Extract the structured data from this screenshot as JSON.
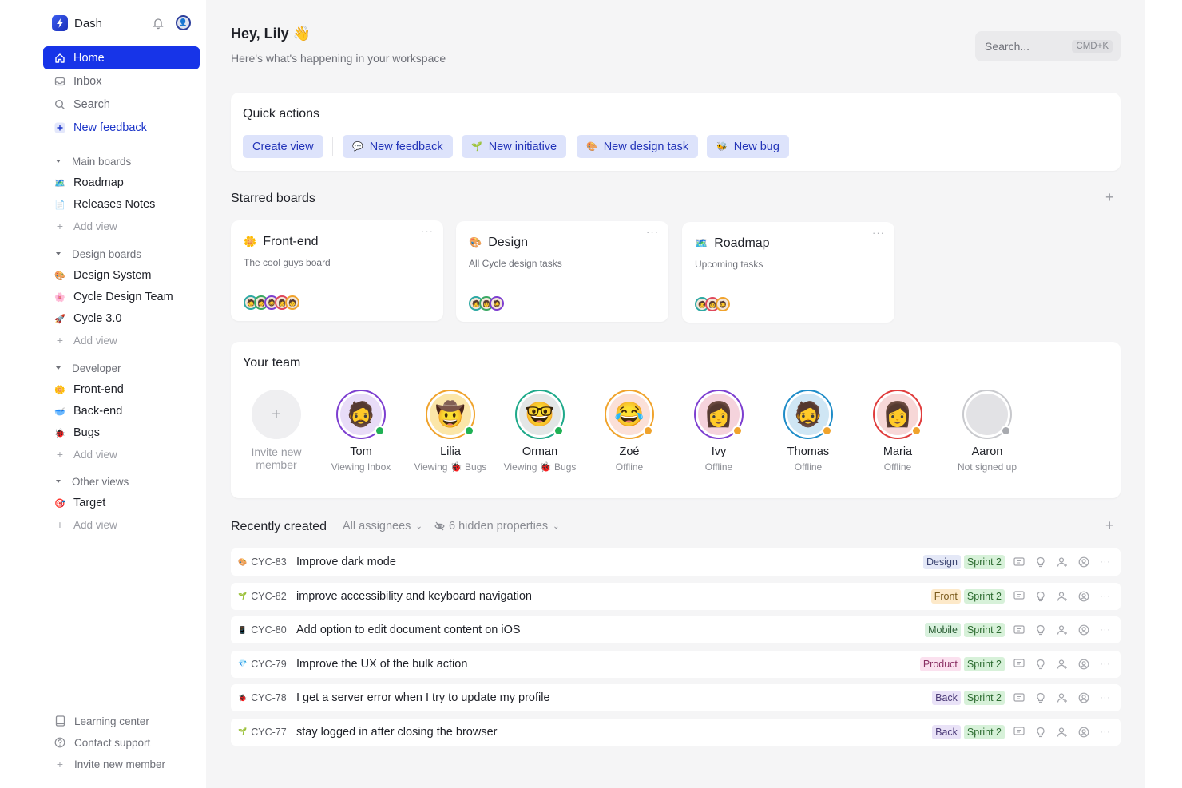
{
  "app": {
    "name": "Dash"
  },
  "sidebar": {
    "nav": [
      {
        "label": "Home",
        "icon": "home-icon"
      },
      {
        "label": "Inbox",
        "icon": "inbox-icon"
      },
      {
        "label": "Search",
        "icon": "search-icon"
      },
      {
        "label": "New feedback",
        "icon": "plus-icon"
      }
    ],
    "sections": [
      {
        "title": "Main boards",
        "items": [
          {
            "label": "Roadmap",
            "emoji": "🗺️"
          },
          {
            "label": "Releases Notes",
            "emoji": "📄"
          }
        ],
        "add_label": "Add view"
      },
      {
        "title": "Design boards",
        "items": [
          {
            "label": "Design System",
            "emoji": "🎨"
          },
          {
            "label": "Cycle Design Team",
            "emoji": "🌸"
          },
          {
            "label": "Cycle 3.0",
            "emoji": "🚀"
          }
        ],
        "add_label": "Add view"
      },
      {
        "title": "Developer",
        "items": [
          {
            "label": "Front-end",
            "emoji": "🌼"
          },
          {
            "label": "Back-end",
            "emoji": "🥣"
          },
          {
            "label": "Bugs",
            "emoji": "🐞"
          }
        ],
        "add_label": "Add view"
      },
      {
        "title": "Other views",
        "items": [
          {
            "label": "Target",
            "emoji": "🎯"
          }
        ],
        "add_label": "Add view"
      }
    ],
    "footer": [
      {
        "label": "Learning center",
        "icon": "book-icon"
      },
      {
        "label": "Contact support",
        "icon": "help-icon"
      },
      {
        "label": "Invite new member",
        "icon": "plus-icon"
      }
    ]
  },
  "header": {
    "greeting": "Hey, Lily 👋",
    "subtitle": "Here's what's happening in your workspace",
    "search_placeholder": "Search...",
    "search_shortcut": "CMD+K"
  },
  "quick_actions": {
    "title": "Quick actions",
    "buttons": [
      {
        "label": "Create view",
        "emoji": ""
      },
      {
        "label": "New feedback",
        "emoji": "💬"
      },
      {
        "label": "New initiative",
        "emoji": "🌱"
      },
      {
        "label": "New design task",
        "emoji": "🎨"
      },
      {
        "label": "New bug",
        "emoji": "🐝"
      }
    ]
  },
  "starred": {
    "title": "Starred boards",
    "boards": [
      {
        "name": "Front-end",
        "emoji": "🌼",
        "subtitle": "The cool guys board",
        "avatars": [
          "#2ea9a4",
          "#3aa864",
          "#7d3fd0",
          "#e0495c",
          "#f0a32c"
        ]
      },
      {
        "name": "Design",
        "emoji": "🎨",
        "subtitle": "All Cycle design tasks",
        "avatars": [
          "#2ea9a4",
          "#3aa864",
          "#7d3fd0"
        ]
      },
      {
        "name": "Roadmap",
        "emoji": "🗺️",
        "subtitle": "Upcoming tasks",
        "avatars": [
          "#2ea9a4",
          "#e0495c",
          "#f0a32c"
        ]
      }
    ]
  },
  "team": {
    "title": "Your team",
    "invite_label": "Invite new member",
    "members": [
      {
        "name": "Tom",
        "status": "Viewing Inbox",
        "face": "🧔",
        "ring": "#7d3fd0",
        "bg": "#e8dcf7",
        "presence": "#1fb154"
      },
      {
        "name": "Lilia",
        "status": "Viewing 🐞 Bugs",
        "face": "🤠",
        "ring": "#f0a32c",
        "bg": "#fbe6a8",
        "presence": "#1fb154"
      },
      {
        "name": "Orman",
        "status": "Viewing 🐞 Bugs",
        "face": "🤓",
        "ring": "#1fa98a",
        "bg": "#e3e6e6",
        "presence": "#1fb154"
      },
      {
        "name": "Zoé",
        "status": "Offline",
        "face": "😂",
        "ring": "#f0a32c",
        "bg": "#fbe0d8",
        "presence": "#f0a32c"
      },
      {
        "name": "Ivy",
        "status": "Offline",
        "face": "👩",
        "ring": "#7d3fd0",
        "bg": "#f5d3dc",
        "presence": "#f0a32c"
      },
      {
        "name": "Thomas",
        "status": "Offline",
        "face": "🧔",
        "ring": "#1e8cc8",
        "bg": "#cfe6f4",
        "presence": "#f0a32c"
      },
      {
        "name": "Maria",
        "status": "Offline",
        "face": "👩",
        "ring": "#e03c3c",
        "bg": "#f7d7d7",
        "presence": "#f0a32c"
      },
      {
        "name": "Aaron",
        "status": "Not signed up",
        "face": "",
        "ring": "#c8c9cd",
        "bg": "#e2e2e5",
        "presence": "#a8aaaf"
      }
    ]
  },
  "recent": {
    "title": "Recently created",
    "filter_assignees": "All assignees",
    "filter_hidden": "6 hidden properties",
    "rows": [
      {
        "id": "CYC-83",
        "emoji": "🎨",
        "title": "Improve dark mode",
        "tag": "Design",
        "tag_bg": "#e4e8f7",
        "tag_fg": "#3a4370",
        "sprint": "Sprint 2"
      },
      {
        "id": "CYC-82",
        "emoji": "🌱",
        "title": "improve accessibility and keyboard navigation",
        "tag": "Front",
        "tag_bg": "#fde9c9",
        "tag_fg": "#7a5a1c",
        "sprint": "Sprint 2"
      },
      {
        "id": "CYC-80",
        "emoji": "📱",
        "title": "Add option to edit document content on iOS",
        "tag": "Mobile",
        "tag_bg": "#d9f1de",
        "tag_fg": "#2c5f36",
        "sprint": "Sprint 2"
      },
      {
        "id": "CYC-79",
        "emoji": "💎",
        "title": "Improve the UX of the bulk action",
        "tag": "Product",
        "tag_bg": "#fbe1ef",
        "tag_fg": "#8a2f63",
        "sprint": "Sprint 2"
      },
      {
        "id": "CYC-78",
        "emoji": "🐞",
        "title": "I get a server error when I try to update my profile",
        "tag": "Back",
        "tag_bg": "#e9e2f7",
        "tag_fg": "#4b3a78",
        "sprint": "Sprint 2"
      },
      {
        "id": "CYC-77",
        "emoji": "🌱",
        "title": "stay logged in after closing the browser",
        "tag": "Back",
        "tag_bg": "#e9e2f7",
        "tag_fg": "#4b3a78",
        "sprint": "Sprint 2"
      }
    ]
  }
}
